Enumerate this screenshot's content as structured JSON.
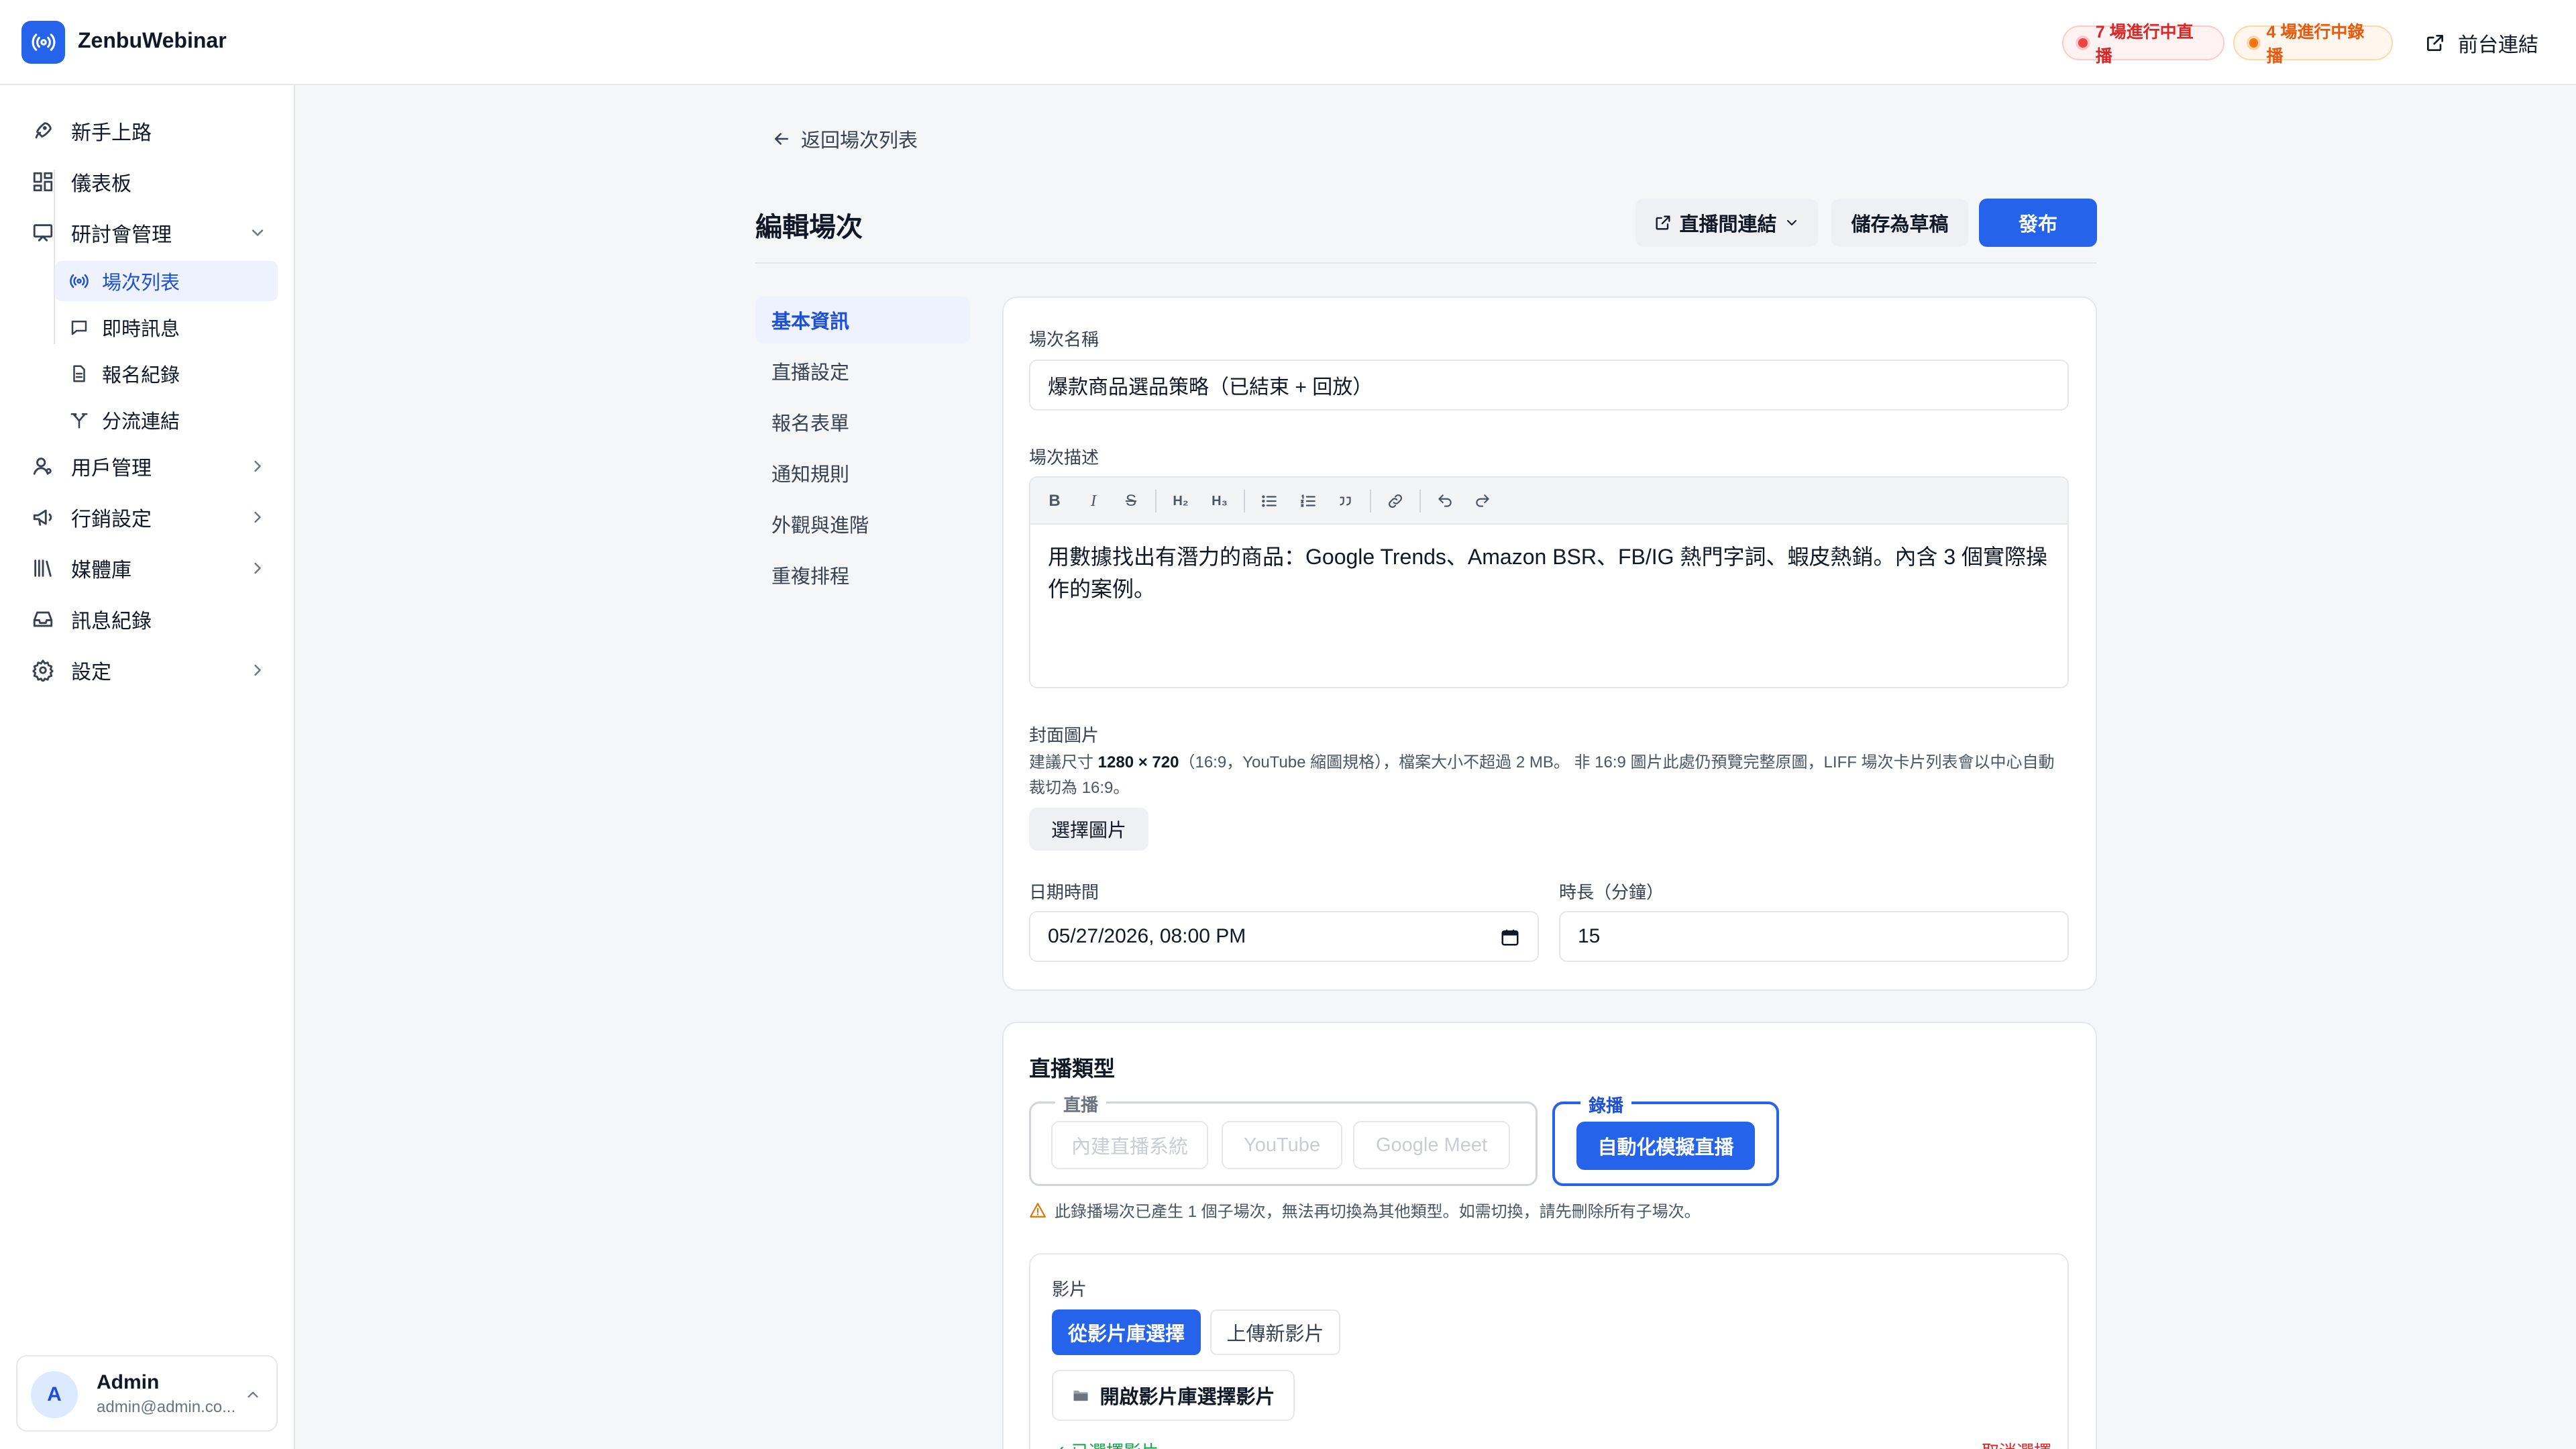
{
  "app": {
    "brand": "ZenbuWebinar",
    "live_badge": "7 場進行中直播",
    "rec_badge": "4 場進行中錄播",
    "front_link": "前台連結"
  },
  "sidebar": {
    "items": [
      {
        "label": "新手上路",
        "icon": "rocket-icon"
      },
      {
        "label": "儀表板",
        "icon": "dashboard-icon"
      },
      {
        "label": "研討會管理",
        "icon": "presentation-icon",
        "expanded": true
      },
      {
        "label": "用戶管理",
        "icon": "users-icon"
      },
      {
        "label": "行銷設定",
        "icon": "megaphone-icon"
      },
      {
        "label": "媒體庫",
        "icon": "library-icon"
      },
      {
        "label": "訊息紀錄",
        "icon": "inbox-icon"
      },
      {
        "label": "設定",
        "icon": "gear-icon"
      }
    ],
    "sub_items": [
      {
        "label": "場次列表",
        "icon": "broadcast-icon",
        "active": true
      },
      {
        "label": "即時訊息",
        "icon": "message-icon"
      },
      {
        "label": "報名紀錄",
        "icon": "document-icon"
      },
      {
        "label": "分流連結",
        "icon": "split-icon"
      }
    ],
    "user": {
      "initial": "A",
      "name": "Admin",
      "email": "admin@admin.co..."
    }
  },
  "page": {
    "back_label": "返回場次列表",
    "title": "編輯場次",
    "live_link_button": "直播間連結",
    "save_draft_button": "儲存為草稿",
    "publish_button": "發布",
    "section_nav": [
      "基本資訊",
      "直播設定",
      "報名表單",
      "通知規則",
      "外觀與進階",
      "重複排程"
    ],
    "active_section": "基本資訊"
  },
  "form": {
    "name_label": "場次名稱",
    "name_value": "爆款商品選品策略（已結束 + 回放）",
    "desc_label": "場次描述",
    "desc_value": "用數據找出有潛力的商品：Google Trends、Amazon BSR、FB/IG 熱門字詞、蝦皮熱銷。內含 3 個實際操作的案例。",
    "cover_label": "封面圖片",
    "cover_hint_prefix": "建議尺寸 ",
    "cover_hint_size": "1280 × 720",
    "cover_hint_rest": "（16:9，YouTube 縮圖規格），檔案大小不超過 2 MB。 非 16:9 圖片此處仍預覽完整原圖，LIFF 場次卡片列表會以中心自動裁切為 16:9。",
    "choose_image_button": "選擇圖片",
    "datetime_label": "日期時間",
    "datetime_value": "05/27/2026, 08:00 PM",
    "duration_label": "時長（分鐘）",
    "duration_value": "15"
  },
  "broadcast": {
    "title": "直播類型",
    "live_group_label": "直播",
    "live_options": [
      "內建直播系統",
      "YouTube",
      "Google Meet"
    ],
    "rec_group_label": "錄播",
    "rec_option": "自動化模擬直播",
    "warning": "此錄播場次已產生 1 個子場次，無法再切換為其他類型。如需切換，請先刪除所有子場次。",
    "video_label": "影片",
    "tab_library": "從影片庫選擇",
    "tab_upload": "上傳新影片",
    "open_library_button": "開啟影片庫選擇影片",
    "selected_note": "✓ 已選擇影片",
    "deselect": "取消選擇"
  },
  "colors": {
    "accent": "#2563eb",
    "live_badge": "#dc2626",
    "rec_badge": "#ea580c"
  }
}
